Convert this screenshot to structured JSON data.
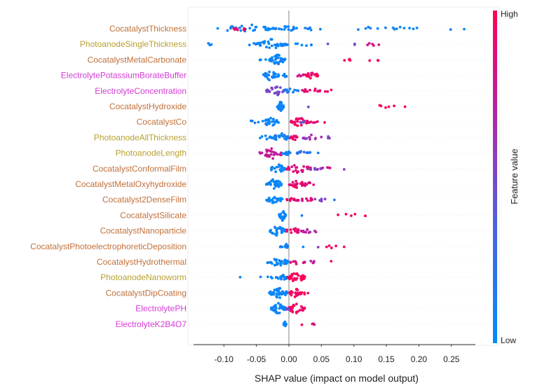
{
  "chart_data": {
    "type": "scatter",
    "subtype": "shap-beeswarm",
    "title": "",
    "xlabel": "SHAP value (impact on model output)",
    "ylabel": "",
    "xlim": [
      -0.148,
      0.285
    ],
    "xticks": [
      -0.1,
      -0.05,
      0.0,
      0.05,
      0.1,
      0.15,
      0.2,
      0.25
    ],
    "xtick_labels": [
      "-0.10",
      "-0.05",
      "0.00",
      "0.05",
      "0.10",
      "0.15",
      "0.20",
      "0.25"
    ],
    "grid": false,
    "colorbar": {
      "label": "Feature value",
      "high_label": "High",
      "low_label": "Low",
      "high_color": "#ff0052",
      "low_color": "#008bfb",
      "placement": "right"
    },
    "category_colors": {
      "Cocatalyst": "#c0703a",
      "Photoanode": "#b8a030",
      "Electrolyte": "#d63ad6"
    },
    "features": [
      {
        "name": "CocatalystThickness",
        "category": "Cocatalyst",
        "clusters": [
          [
            -0.11,
            -0.02,
            30,
            0.05
          ],
          [
            -0.085,
            -0.065,
            10,
            0.9
          ],
          [
            -0.02,
            0.02,
            14,
            0.05
          ],
          [
            0.02,
            0.06,
            6,
            0.05
          ],
          [
            0.075,
            0.2,
            14,
            0.05
          ],
          [
            0.24,
            0.27,
            2,
            0.05
          ]
        ]
      },
      {
        "name": "PhotoanodeSingleThickness",
        "category": "Photoanode",
        "clusters": [
          [
            -0.135,
            -0.115,
            3,
            0.05
          ],
          [
            -0.065,
            -0.05,
            3,
            0.05
          ],
          [
            -0.05,
            -0.002,
            40,
            0.05
          ],
          [
            0.01,
            0.045,
            6,
            0.05
          ],
          [
            0.06,
            0.065,
            1,
            0.4
          ],
          [
            0.1,
            0.105,
            2,
            0.5
          ],
          [
            0.12,
            0.14,
            5,
            0.85
          ]
        ]
      },
      {
        "name": "CocatalystMetalCarbonate",
        "category": "Cocatalyst",
        "clusters": [
          [
            -0.05,
            -0.035,
            3,
            0.05
          ],
          [
            -0.03,
            -0.005,
            40,
            0.05
          ],
          [
            0.083,
            0.1,
            4,
            0.95
          ],
          [
            0.118,
            0.14,
            3,
            0.95
          ]
        ]
      },
      {
        "name": "ElectrolytePotassiumBorateBuffer",
        "category": "Electrolyte",
        "clusters": [
          [
            -0.045,
            -0.015,
            25,
            0.05
          ],
          [
            -0.012,
            0.0,
            6,
            0.1
          ],
          [
            0.01,
            0.025,
            5,
            0.8
          ],
          [
            0.025,
            0.045,
            20,
            0.95
          ]
        ]
      },
      {
        "name": "ElectrolyteConcentration",
        "category": "Electrolyte",
        "clusters": [
          [
            -0.035,
            -0.005,
            30,
            0.5
          ],
          [
            -0.01,
            0.015,
            10,
            0.1
          ],
          [
            0.02,
            0.05,
            14,
            0.9
          ],
          [
            0.055,
            0.075,
            3,
            0.95
          ]
        ]
      },
      {
        "name": "CocatalystHydroxide",
        "category": "Cocatalyst",
        "clusters": [
          [
            -0.018,
            -0.008,
            35,
            0.05
          ],
          [
            0.03,
            0.03,
            1,
            0.45
          ],
          [
            0.125,
            0.19,
            6,
            0.95
          ]
        ]
      },
      {
        "name": "CocatalystCo",
        "category": "Cocatalyst",
        "clusters": [
          [
            -0.065,
            -0.045,
            5,
            0.05
          ],
          [
            -0.042,
            -0.015,
            25,
            0.05
          ],
          [
            0.002,
            0.03,
            25,
            0.95
          ],
          [
            0.018,
            0.03,
            4,
            0.45
          ],
          [
            0.03,
            0.045,
            5,
            0.9
          ],
          [
            0.055,
            0.055,
            1,
            0.95
          ]
        ]
      },
      {
        "name": "PhotoanodeAllThickness",
        "category": "Photoanode",
        "clusters": [
          [
            -0.045,
            -0.025,
            8,
            0.05
          ],
          [
            -0.025,
            0.0,
            25,
            0.1
          ],
          [
            0.0,
            0.02,
            10,
            0.9
          ],
          [
            0.02,
            0.05,
            12,
            0.6
          ],
          [
            0.05,
            0.065,
            4,
            0.5
          ]
        ]
      },
      {
        "name": "PhotoanodeLength",
        "category": "Photoanode",
        "clusters": [
          [
            -0.045,
            -0.005,
            30,
            0.75
          ],
          [
            -0.01,
            0.005,
            8,
            0.1
          ],
          [
            0.01,
            0.03,
            10,
            0.2
          ],
          [
            0.03,
            0.05,
            3,
            0.1
          ]
        ]
      },
      {
        "name": "CocatalystConformalFilm",
        "category": "Cocatalyst",
        "clusters": [
          [
            -0.03,
            -0.005,
            25,
            0.05
          ],
          [
            -0.005,
            0.035,
            25,
            0.85
          ],
          [
            0.03,
            0.05,
            8,
            0.55
          ],
          [
            0.05,
            0.065,
            4,
            0.8
          ],
          [
            0.085,
            0.085,
            1,
            0.5
          ]
        ]
      },
      {
        "name": "CocatalystMetalOxyhydroxide",
        "category": "Cocatalyst",
        "clusters": [
          [
            -0.035,
            -0.01,
            35,
            0.05
          ],
          [
            0.0,
            0.025,
            22,
            0.9
          ],
          [
            0.02,
            0.038,
            10,
            0.85
          ]
        ]
      },
      {
        "name": "Cocatalyst2DenseFilm",
        "category": "Cocatalyst",
        "clusters": [
          [
            -0.035,
            -0.01,
            25,
            0.05
          ],
          [
            -0.005,
            0.01,
            8,
            0.9
          ],
          [
            0.01,
            0.04,
            12,
            0.85
          ],
          [
            0.04,
            0.06,
            5,
            0.55
          ],
          [
            0.07,
            0.075,
            1,
            0.2
          ]
        ]
      },
      {
        "name": "CocatalystSilicate",
        "category": "Cocatalyst",
        "clusters": [
          [
            -0.015,
            -0.005,
            30,
            0.05
          ],
          [
            0.02,
            0.02,
            1,
            0.05
          ],
          [
            0.072,
            0.12,
            6,
            0.95
          ]
        ]
      },
      {
        "name": "CocatalystNanoparticle",
        "category": "Cocatalyst",
        "clusters": [
          [
            -0.03,
            -0.005,
            30,
            0.05
          ],
          [
            -0.005,
            0.02,
            15,
            0.9
          ],
          [
            0.02,
            0.045,
            12,
            0.7
          ]
        ]
      },
      {
        "name": "CocatalystPhotoelectrophoreticDeposition",
        "category": "Cocatalyst",
        "clusters": [
          [
            -0.015,
            -0.008,
            3,
            0.05
          ],
          [
            -0.006,
            -0.002,
            15,
            0.05
          ],
          [
            0.022,
            0.022,
            1,
            0.05
          ],
          [
            0.045,
            0.045,
            1,
            0.5
          ],
          [
            0.058,
            0.073,
            5,
            0.95
          ],
          [
            0.085,
            0.085,
            1,
            0.95
          ]
        ]
      },
      {
        "name": "CocatalystHydrothermal",
        "category": "Cocatalyst",
        "clusters": [
          [
            -0.04,
            -0.03,
            2,
            0.05
          ],
          [
            -0.03,
            0.0,
            30,
            0.05
          ],
          [
            0.0,
            0.025,
            10,
            0.85
          ],
          [
            0.03,
            0.04,
            5,
            0.7
          ],
          [
            0.065,
            0.065,
            1,
            0.95
          ]
        ]
      },
      {
        "name": "PhotoanodeNanoworm",
        "category": "Photoanode",
        "clusters": [
          [
            -0.075,
            -0.075,
            1,
            0.05
          ],
          [
            -0.045,
            -0.025,
            4,
            0.05
          ],
          [
            -0.02,
            -0.002,
            15,
            0.05
          ],
          [
            -0.002,
            0.025,
            40,
            0.97
          ]
        ]
      },
      {
        "name": "CocatalystDipCoating",
        "category": "Cocatalyst",
        "clusters": [
          [
            -0.03,
            -0.002,
            40,
            0.05
          ],
          [
            0.0,
            0.02,
            25,
            0.95
          ],
          [
            0.018,
            0.03,
            4,
            0.95
          ]
        ]
      },
      {
        "name": "ElectrolytePH",
        "category": "Electrolyte",
        "clusters": [
          [
            -0.028,
            -0.005,
            35,
            0.05
          ],
          [
            -0.002,
            0.025,
            30,
            0.95
          ],
          [
            -0.005,
            0.005,
            5,
            0.5
          ]
        ]
      },
      {
        "name": "ElectrolyteK2B4O7",
        "category": "Electrolyte",
        "clusters": [
          [
            -0.008,
            -0.004,
            12,
            0.05
          ],
          [
            0.02,
            0.02,
            1,
            0.95
          ],
          [
            0.033,
            0.04,
            3,
            0.85
          ]
        ]
      }
    ]
  }
}
